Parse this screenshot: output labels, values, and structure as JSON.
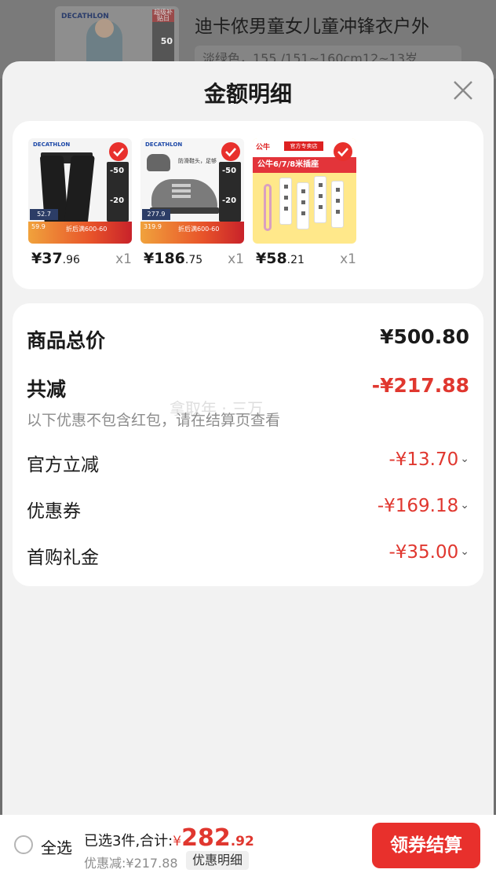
{
  "background": {
    "product_title": "迪卡侬男童女儿童冲锋衣户外",
    "variant": "淡绿色，155 /151~160cm12~13岁",
    "thumb_brand": "DECATHLON",
    "thumb_tag": "超级补贴日",
    "thumb_tag_value": "50"
  },
  "sheet": {
    "title": "金额明细"
  },
  "products": [
    {
      "price_int": "¥37",
      "price_dec": ".96",
      "qty": "x1",
      "brand": "DECATHLON",
      "tag1": "-50",
      "tag2": "-20",
      "orig": "52.7",
      "promo1": "59.9",
      "promo2": "折后满600-60"
    },
    {
      "price_int": "¥186",
      "price_dec": ".75",
      "qty": "x1",
      "brand": "DECATHLON",
      "tag1": "-50",
      "tag2": "-20",
      "orig": "277.9",
      "promo1": "319.9",
      "promo2": "折后满600-60",
      "caption": "防滑鞋头，足够"
    },
    {
      "price_int": "¥58",
      "price_dec": ".21",
      "qty": "x1",
      "logo": "公牛",
      "badge": "官方专卖店",
      "band": "公牛6/7/8米插座"
    }
  ],
  "details": {
    "total_label": "商品总价",
    "total_value": "¥500.80",
    "reduce_label": "共减",
    "reduce_value": "-¥217.88",
    "note": "以下优惠不包含红包，请在结算页查看",
    "watermark": "拿取年 · 三万",
    "rows": [
      {
        "label": "官方立减",
        "value": "-¥13.70"
      },
      {
        "label": "优惠券",
        "value": "-¥169.18"
      },
      {
        "label": "首购礼金",
        "value": "-¥35.00"
      }
    ]
  },
  "bottom": {
    "select_all": "全选",
    "selected_text": "已选3件,合计:",
    "yen": "¥",
    "total_int": "282",
    "total_dec": ".92",
    "saved": "优惠减:¥217.88",
    "detail_link": "优惠明细",
    "checkout": "领券结算"
  },
  "colors": {
    "accent": "#e8302c",
    "price_red": "#e0372f"
  }
}
